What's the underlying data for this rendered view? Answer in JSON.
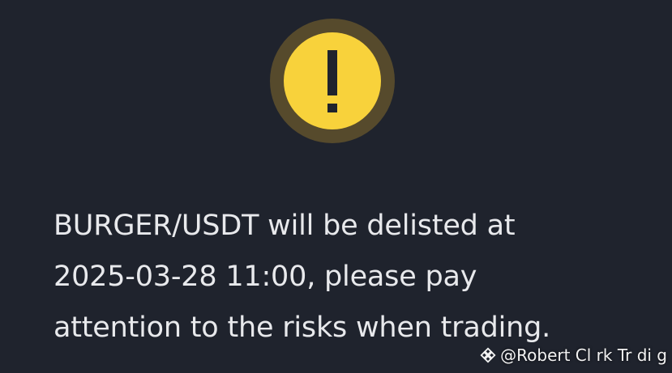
{
  "notice": {
    "icon": "exclamation-warning-icon",
    "lines": [
      "BURGER/USDT will be delisted at",
      "2025-03-28 11:00, please pay",
      "attention to the risks when trading."
    ]
  },
  "watermark": {
    "icon": "binance-diamond-logo-icon",
    "text": "@Robert Cl rk Tr di g"
  },
  "colors": {
    "background": "#1f232d",
    "warning_yellow": "#f8d23b",
    "warning_ring": "#564a2c",
    "text": "#e8e9ec"
  }
}
